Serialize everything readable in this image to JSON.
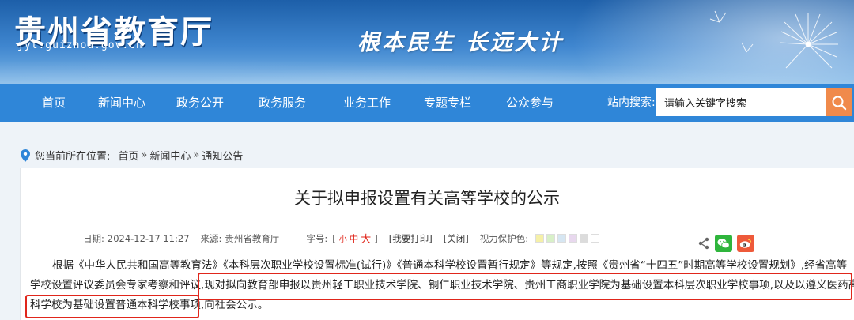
{
  "header": {
    "site_title": "贵州省教育厅",
    "site_domain": "jyt.guizhou.gov.cn",
    "slogan": "根本民生 长远大计"
  },
  "nav": {
    "items": [
      "首页",
      "新闻中心",
      "政务公开",
      "政务服务",
      "业务工作",
      "专题专栏",
      "公众参与"
    ],
    "search_label": "站内搜索:",
    "search_placeholder": "请输入关键字搜索"
  },
  "breadcrumb": {
    "prefix": "您当前所在位置:",
    "items": [
      "首页",
      "新闻中心",
      "通知公告"
    ],
    "separator": "»"
  },
  "article": {
    "title": "关于拟申报设置有关高等学校的公示",
    "date_label": "日期:",
    "date": "2024-12-17 11:27",
    "source_label": "来源:",
    "source": "贵州省教育厅",
    "font_label": "字号:",
    "font_open": "[",
    "font_small": "小",
    "font_medium": "中",
    "font_large": "大",
    "font_close": "]",
    "print_label": "[我要打印]",
    "close_label": "[关闭]",
    "eye_label": "视力保护色:",
    "eye_colors": [
      "#f5f0a8",
      "#d8f0c8",
      "#d6e6f2",
      "#e8d8ee",
      "#dcdcdc",
      "#ffffff"
    ],
    "body_line1": "根据《中华人民共和国高等教育法》《本科层次职业学校设置标准(试行)》《普通本科学校设置暂行规定》等规定,按照《贵州省“十四五”时期高等学校设置规划》,经省高等",
    "body_line2a": "学校设置评议委员会专家考察和评议,",
    "body_line2b": "现对拟向教育部申报以贵州轻工职业技术学院、铜仁职业技术学院、贵州工商职业学院为基础设置本科层次职业学校事项,以及以遵义医药高等专",
    "body_line3a": "科学校为基础设置普通本科学校事项,",
    "body_line3b": "向社会公示。"
  },
  "colors": {
    "nav_bg": "#2f86d8",
    "search_btn": "#f08a4b",
    "highlight": "#e0261b",
    "wechat": "#2fb53c",
    "weibo": "#ee5a3a"
  },
  "icons": [
    "location-pin-icon",
    "search-icon",
    "share-icon",
    "wechat-icon",
    "weibo-icon",
    "dandelion-icon"
  ]
}
